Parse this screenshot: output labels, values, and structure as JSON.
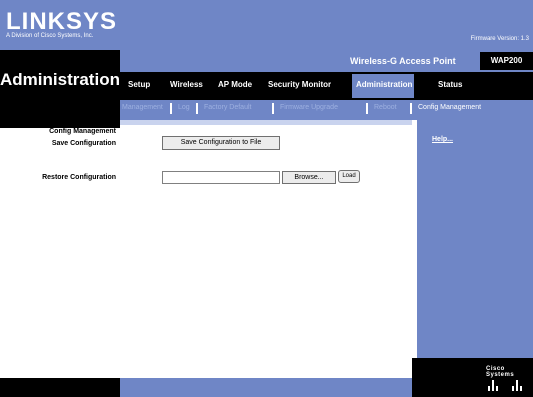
{
  "brand": {
    "logo_text": "LINKSYS",
    "logo_subtext": "A Division of Cisco Systems, Inc.",
    "firmware": "Firmware Version: 1.3"
  },
  "section_title": "Administration",
  "product": {
    "name": "Wireless-G Access Point",
    "model": "WAP200"
  },
  "main_tabs": [
    {
      "label": "Setup"
    },
    {
      "label": "Wireless"
    },
    {
      "label": "AP Mode"
    },
    {
      "label": "Security Monitor"
    },
    {
      "label": "Administration"
    },
    {
      "label": "Status"
    }
  ],
  "sub_tabs": [
    {
      "label": "Management"
    },
    {
      "label": "Log"
    },
    {
      "label": "Factory Default"
    },
    {
      "label": "Firmware Upgrade"
    },
    {
      "label": "Reboot"
    },
    {
      "label": "Config Management"
    }
  ],
  "left_labels": {
    "section": "Config Management",
    "save": "Save Configuration",
    "restore": "Restore Configuration"
  },
  "buttons": {
    "save_to_file": "Save Configuration to File",
    "browse": "Browse...",
    "load": "Load"
  },
  "restore_input": {
    "value": ""
  },
  "help": {
    "link": "Help..."
  },
  "footer_brand": {
    "cisco": "Cisco Systems"
  },
  "colors": {
    "accent_blue": "#6f86c6",
    "black": "#000000"
  }
}
